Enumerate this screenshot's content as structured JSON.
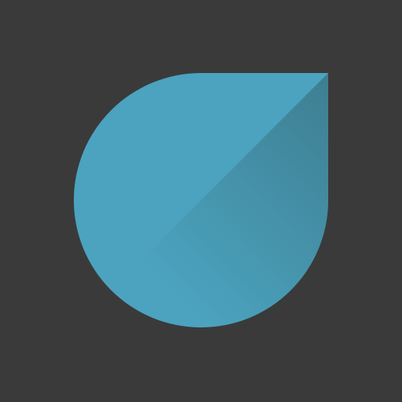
{
  "icon": {
    "name": "droplet-logo-icon",
    "background_color": "#3a3a3a",
    "primary_color": "#4ba3bf",
    "shadow_color": "#3e7e91"
  }
}
